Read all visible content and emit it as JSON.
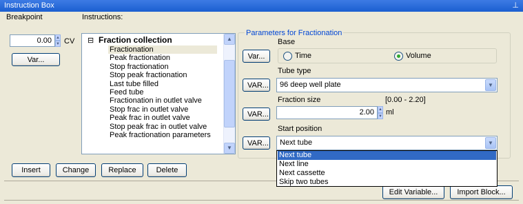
{
  "window": {
    "title": "Instruction Box",
    "pin_icon": "pin-icon"
  },
  "breakpoint": {
    "label": "Breakpoint",
    "value": "0.00",
    "unit": "CV",
    "var_button": "Var..."
  },
  "instructions": {
    "label": "Instructions:",
    "group_title": "Fraction collection",
    "collapse_glyph": "⊟",
    "items": [
      "Fractionation",
      "Peak fractionation",
      "Stop fractionation",
      "Stop peak fractionation",
      "Last tube filled",
      "Feed tube",
      "Fractionation in outlet valve",
      "Stop frac in outlet valve",
      "Peak frac in outlet valve",
      "Stop peak frac in outlet valve",
      "Peak fractionation parameters"
    ],
    "selected_index": 0
  },
  "parameters": {
    "legend": "Parameters for Fractionation",
    "base": {
      "label": "Base",
      "var_button": "Var...",
      "options": [
        "Time",
        "Volume"
      ],
      "selected": "Volume"
    },
    "tube_type": {
      "label": "Tube type",
      "var_button": "VAR...",
      "value": "96 deep well plate"
    },
    "fraction_size": {
      "label": "Fraction size",
      "range": "[0.00 - 2.20]",
      "var_button": "VAR...",
      "value": "2.00",
      "unit": "ml"
    },
    "start_position": {
      "label": "Start position",
      "var_button": "VAR...",
      "value": "Next tube",
      "options": [
        "Next tube",
        "Next line",
        "Next cassette",
        "Skip two tubes"
      ]
    }
  },
  "actions": {
    "insert": "Insert",
    "change": "Change",
    "replace": "Replace",
    "delete": "Delete"
  },
  "footer": {
    "edit_variable": "Edit Variable...",
    "import_block": "Import Block..."
  },
  "colors": {
    "titlebar": "#1b5fd0",
    "selection": "#316ac5",
    "legend": "#0046d5",
    "panel": "#ece9d8"
  }
}
